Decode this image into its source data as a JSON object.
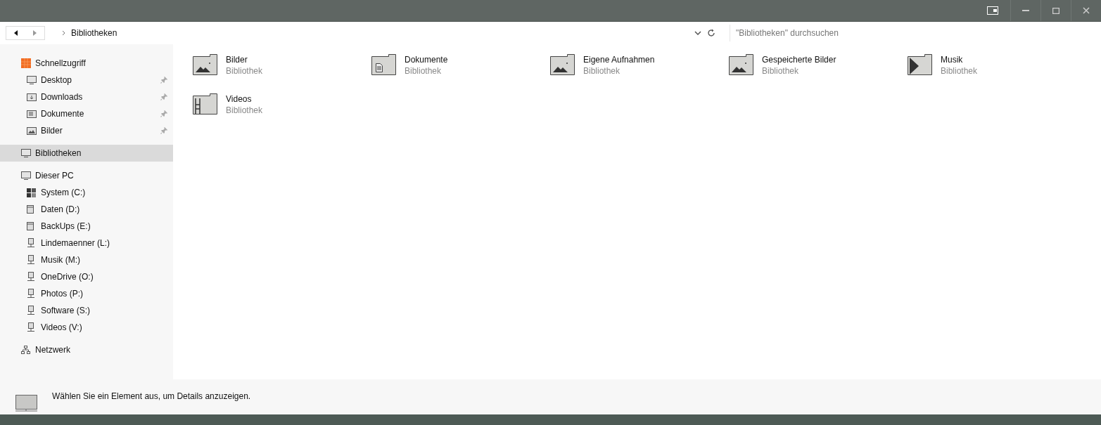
{
  "address_bar": {
    "path": "Bibliotheken"
  },
  "search": {
    "placeholder": "\"Bibliotheken\" durchsuchen"
  },
  "sidebar": {
    "groups": [
      {
        "label": "Schnellzugriff",
        "kind": "quick",
        "selected": false,
        "children": [
          {
            "label": "Desktop",
            "kind": "monitor",
            "pinned": true,
            "selected": false
          },
          {
            "label": "Downloads",
            "kind": "download",
            "pinned": true,
            "selected": false
          },
          {
            "label": "Dokumente",
            "kind": "document",
            "pinned": true,
            "selected": false
          },
          {
            "label": "Bilder",
            "kind": "picture",
            "pinned": true,
            "selected": false
          }
        ]
      },
      {
        "label": "Bibliotheken",
        "kind": "monitor",
        "selected": true
      },
      {
        "label": "Dieser PC",
        "kind": "monitor",
        "selected": false,
        "children": [
          {
            "label": "System (C:)",
            "kind": "system-drive",
            "pinned": false,
            "selected": false
          },
          {
            "label": "Daten (D:)",
            "kind": "drive",
            "pinned": false,
            "selected": false
          },
          {
            "label": "BackUps (E:)",
            "kind": "drive",
            "pinned": false,
            "selected": false
          },
          {
            "label": "Lindemaenner (L:)",
            "kind": "network-drive",
            "pinned": false,
            "selected": false
          },
          {
            "label": "Musik (M:)",
            "kind": "network-drive",
            "pinned": false,
            "selected": false
          },
          {
            "label": "OneDrive (O:)",
            "kind": "network-drive",
            "pinned": false,
            "selected": false
          },
          {
            "label": "Photos (P:)",
            "kind": "network-drive",
            "pinned": false,
            "selected": false
          },
          {
            "label": "Software (S:)",
            "kind": "network-drive",
            "pinned": false,
            "selected": false
          },
          {
            "label": "Videos (V:)",
            "kind": "network-drive",
            "pinned": false,
            "selected": false
          }
        ]
      },
      {
        "label": "Netzwerk",
        "kind": "network",
        "selected": false
      }
    ]
  },
  "libraries": [
    {
      "name": "Bilder",
      "type": "Bibliothek",
      "kind": "picture"
    },
    {
      "name": "Dokumente",
      "type": "Bibliothek",
      "kind": "document"
    },
    {
      "name": "Eigene Aufnahmen",
      "type": "Bibliothek",
      "kind": "picture"
    },
    {
      "name": "Gespeicherte Bilder",
      "type": "Bibliothek",
      "kind": "picture"
    },
    {
      "name": "Musik",
      "type": "Bibliothek",
      "kind": "music"
    },
    {
      "name": "Videos",
      "type": "Bibliothek",
      "kind": "video"
    }
  ],
  "details_pane": {
    "message": "Wählen Sie ein Element aus, um Details anzuzeigen."
  }
}
